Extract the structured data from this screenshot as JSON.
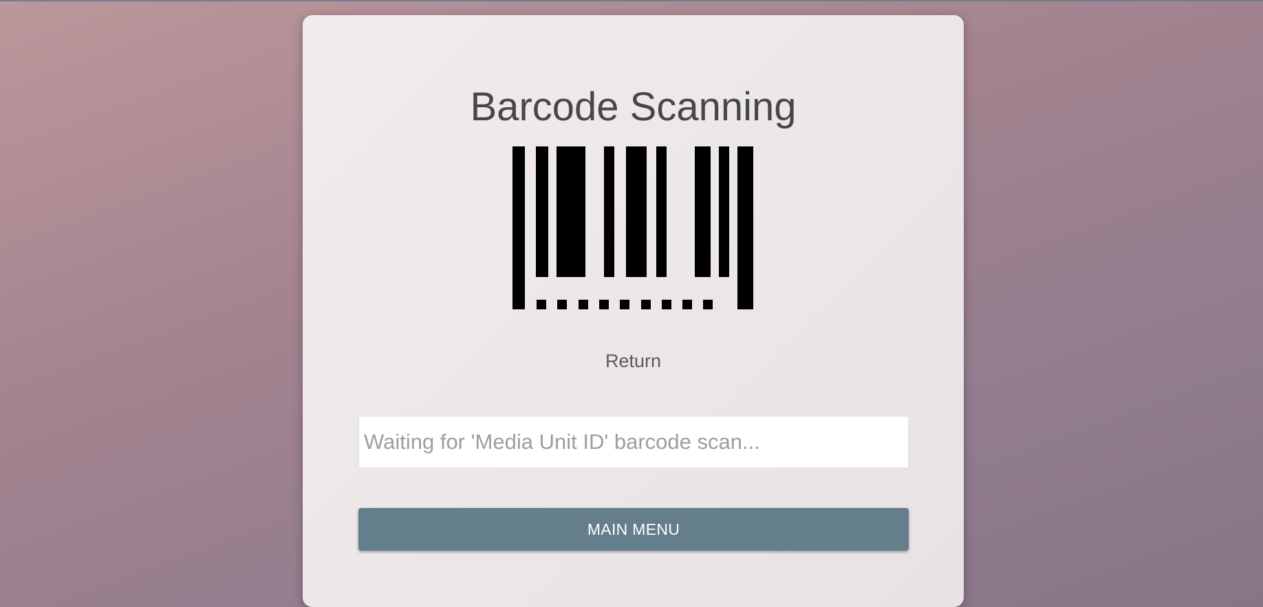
{
  "page": {
    "title": "Barcode Scanning",
    "status_text": "Return"
  },
  "barcode_icon": {
    "name": "barcode-icon",
    "color": "#000000"
  },
  "scan_input": {
    "value": "",
    "placeholder": "Waiting for 'Media Unit ID' barcode scan..."
  },
  "main_menu_button": {
    "label": "MAIN MENU",
    "color": "#647e8c"
  },
  "colors": {
    "card_background": "#ece7e8",
    "title_text": "#474747",
    "page_gradient_start": "#bc979b",
    "page_gradient_end": "#867586"
  }
}
